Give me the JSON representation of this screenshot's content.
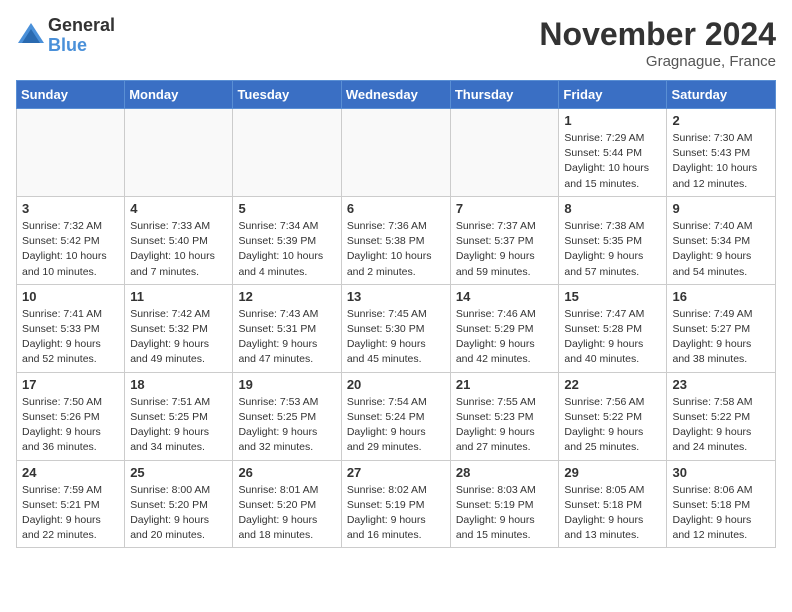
{
  "logo": {
    "general": "General",
    "blue": "Blue"
  },
  "title": {
    "month": "November 2024",
    "location": "Gragnague, France"
  },
  "days_of_week": [
    "Sunday",
    "Monday",
    "Tuesday",
    "Wednesday",
    "Thursday",
    "Friday",
    "Saturday"
  ],
  "weeks": [
    [
      {
        "day": "",
        "info": ""
      },
      {
        "day": "",
        "info": ""
      },
      {
        "day": "",
        "info": ""
      },
      {
        "day": "",
        "info": ""
      },
      {
        "day": "",
        "info": ""
      },
      {
        "day": "1",
        "info": "Sunrise: 7:29 AM\nSunset: 5:44 PM\nDaylight: 10 hours and 15 minutes."
      },
      {
        "day": "2",
        "info": "Sunrise: 7:30 AM\nSunset: 5:43 PM\nDaylight: 10 hours and 12 minutes."
      }
    ],
    [
      {
        "day": "3",
        "info": "Sunrise: 7:32 AM\nSunset: 5:42 PM\nDaylight: 10 hours and 10 minutes."
      },
      {
        "day": "4",
        "info": "Sunrise: 7:33 AM\nSunset: 5:40 PM\nDaylight: 10 hours and 7 minutes."
      },
      {
        "day": "5",
        "info": "Sunrise: 7:34 AM\nSunset: 5:39 PM\nDaylight: 10 hours and 4 minutes."
      },
      {
        "day": "6",
        "info": "Sunrise: 7:36 AM\nSunset: 5:38 PM\nDaylight: 10 hours and 2 minutes."
      },
      {
        "day": "7",
        "info": "Sunrise: 7:37 AM\nSunset: 5:37 PM\nDaylight: 9 hours and 59 minutes."
      },
      {
        "day": "8",
        "info": "Sunrise: 7:38 AM\nSunset: 5:35 PM\nDaylight: 9 hours and 57 minutes."
      },
      {
        "day": "9",
        "info": "Sunrise: 7:40 AM\nSunset: 5:34 PM\nDaylight: 9 hours and 54 minutes."
      }
    ],
    [
      {
        "day": "10",
        "info": "Sunrise: 7:41 AM\nSunset: 5:33 PM\nDaylight: 9 hours and 52 minutes."
      },
      {
        "day": "11",
        "info": "Sunrise: 7:42 AM\nSunset: 5:32 PM\nDaylight: 9 hours and 49 minutes."
      },
      {
        "day": "12",
        "info": "Sunrise: 7:43 AM\nSunset: 5:31 PM\nDaylight: 9 hours and 47 minutes."
      },
      {
        "day": "13",
        "info": "Sunrise: 7:45 AM\nSunset: 5:30 PM\nDaylight: 9 hours and 45 minutes."
      },
      {
        "day": "14",
        "info": "Sunrise: 7:46 AM\nSunset: 5:29 PM\nDaylight: 9 hours and 42 minutes."
      },
      {
        "day": "15",
        "info": "Sunrise: 7:47 AM\nSunset: 5:28 PM\nDaylight: 9 hours and 40 minutes."
      },
      {
        "day": "16",
        "info": "Sunrise: 7:49 AM\nSunset: 5:27 PM\nDaylight: 9 hours and 38 minutes."
      }
    ],
    [
      {
        "day": "17",
        "info": "Sunrise: 7:50 AM\nSunset: 5:26 PM\nDaylight: 9 hours and 36 minutes."
      },
      {
        "day": "18",
        "info": "Sunrise: 7:51 AM\nSunset: 5:25 PM\nDaylight: 9 hours and 34 minutes."
      },
      {
        "day": "19",
        "info": "Sunrise: 7:53 AM\nSunset: 5:25 PM\nDaylight: 9 hours and 32 minutes."
      },
      {
        "day": "20",
        "info": "Sunrise: 7:54 AM\nSunset: 5:24 PM\nDaylight: 9 hours and 29 minutes."
      },
      {
        "day": "21",
        "info": "Sunrise: 7:55 AM\nSunset: 5:23 PM\nDaylight: 9 hours and 27 minutes."
      },
      {
        "day": "22",
        "info": "Sunrise: 7:56 AM\nSunset: 5:22 PM\nDaylight: 9 hours and 25 minutes."
      },
      {
        "day": "23",
        "info": "Sunrise: 7:58 AM\nSunset: 5:22 PM\nDaylight: 9 hours and 24 minutes."
      }
    ],
    [
      {
        "day": "24",
        "info": "Sunrise: 7:59 AM\nSunset: 5:21 PM\nDaylight: 9 hours and 22 minutes."
      },
      {
        "day": "25",
        "info": "Sunrise: 8:00 AM\nSunset: 5:20 PM\nDaylight: 9 hours and 20 minutes."
      },
      {
        "day": "26",
        "info": "Sunrise: 8:01 AM\nSunset: 5:20 PM\nDaylight: 9 hours and 18 minutes."
      },
      {
        "day": "27",
        "info": "Sunrise: 8:02 AM\nSunset: 5:19 PM\nDaylight: 9 hours and 16 minutes."
      },
      {
        "day": "28",
        "info": "Sunrise: 8:03 AM\nSunset: 5:19 PM\nDaylight: 9 hours and 15 minutes."
      },
      {
        "day": "29",
        "info": "Sunrise: 8:05 AM\nSunset: 5:18 PM\nDaylight: 9 hours and 13 minutes."
      },
      {
        "day": "30",
        "info": "Sunrise: 8:06 AM\nSunset: 5:18 PM\nDaylight: 9 hours and 12 minutes."
      }
    ]
  ]
}
